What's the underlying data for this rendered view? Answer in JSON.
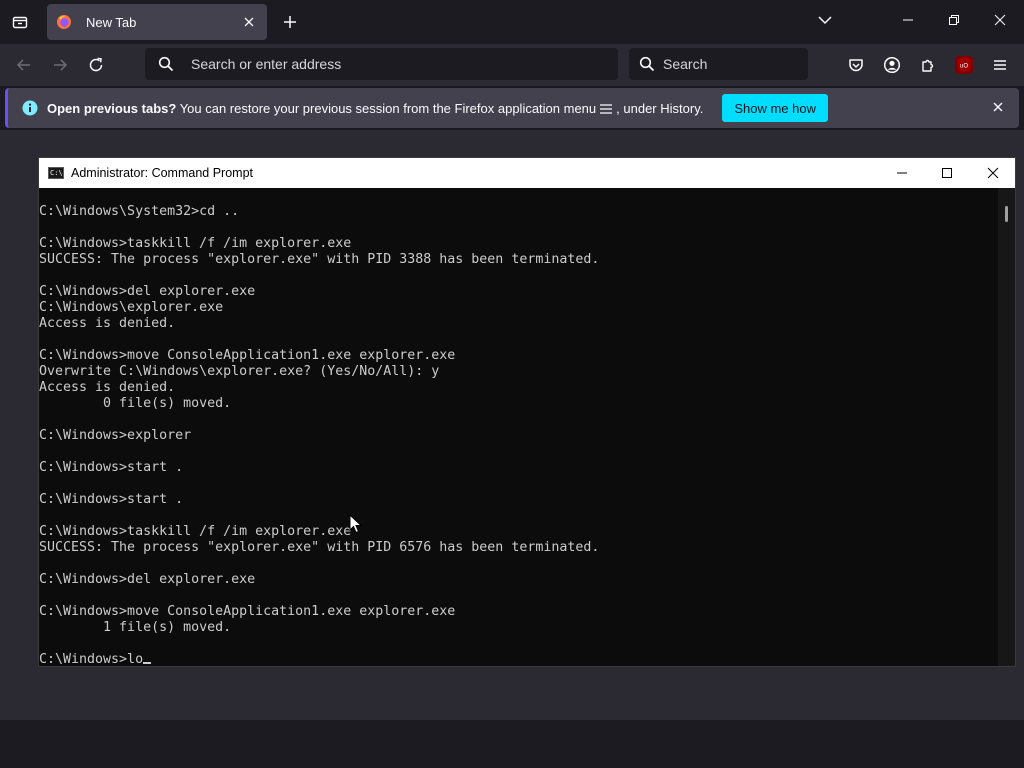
{
  "browser": {
    "tab": {
      "title": "New Tab",
      "favicon": "firefox-icon"
    },
    "urlbar": {
      "placeholder": "Search or enter address"
    },
    "searchbar": {
      "placeholder": "Search"
    },
    "toolbar_icons": [
      "pocket-icon",
      "account-icon",
      "extensions-icon",
      "ublock-icon",
      "menu-icon"
    ],
    "ublock_badge": "uO"
  },
  "notification": {
    "bold": "Open previous tabs?",
    "text_before_icon": " You can restore your previous session from the Firefox application menu",
    "text_after_icon": ", under History.",
    "button": "Show me how"
  },
  "cmd": {
    "title": "Administrator: Command Prompt",
    "icon_text": "C:\\",
    "lines": [
      "C:\\Windows\\System32>cd ..",
      "",
      "C:\\Windows>taskkill /f /im explorer.exe",
      "SUCCESS: The process \"explorer.exe\" with PID 3388 has been terminated.",
      "",
      "C:\\Windows>del explorer.exe",
      "C:\\Windows\\explorer.exe",
      "Access is denied.",
      "",
      "C:\\Windows>move ConsoleApplication1.exe explorer.exe",
      "Overwrite C:\\Windows\\explorer.exe? (Yes/No/All): y",
      "Access is denied.",
      "        0 file(s) moved.",
      "",
      "C:\\Windows>explorer",
      "",
      "C:\\Windows>start .",
      "",
      "C:\\Windows>start .",
      "",
      "C:\\Windows>taskkill /f /im explorer.exe",
      "SUCCESS: The process \"explorer.exe\" with PID 6576 has been terminated.",
      "",
      "C:\\Windows>del explorer.exe",
      "",
      "C:\\Windows>move ConsoleApplication1.exe explorer.exe",
      "        1 file(s) moved.",
      ""
    ],
    "current_input": "C:\\Windows>lo"
  },
  "colors": {
    "firefox_tabbar": "#1c1b22",
    "firefox_toolbar": "#2b2a33",
    "accent_button": "#00ddff",
    "console_bg": "#0c0c0c",
    "console_text": "#cccccc"
  }
}
